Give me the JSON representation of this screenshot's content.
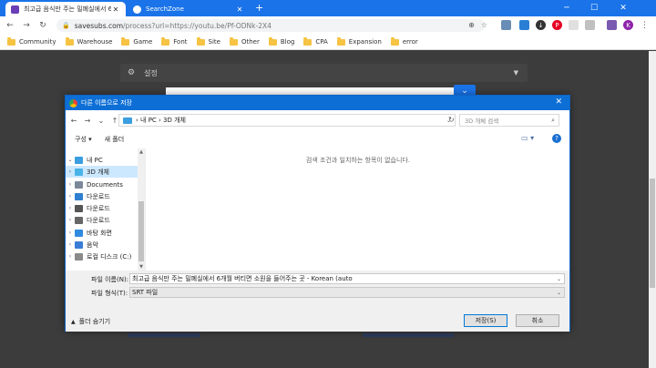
{
  "browser": {
    "tabs": [
      {
        "title": "최고급 음식만 주는 밀폐실에서 6..."
      },
      {
        "title": "SearchZone"
      }
    ],
    "new_tab": "+",
    "url_host": "savesubs.com",
    "url_path": "/process?url=https://youtu.be/Pf-ODNk-2X4",
    "avatar_letter": "K",
    "bookmarks": [
      "Community",
      "Warehouse",
      "Game",
      "Font",
      "Site",
      "Other",
      "Blog",
      "CPA",
      "Expansion",
      "error"
    ]
  },
  "page": {
    "settings_label": "설정"
  },
  "dialog": {
    "title": "다른 이름으로 저장",
    "breadcrumb": "›  내 PC  ›  3D 개체",
    "search_placeholder": "3D 개체 검색",
    "commands": {
      "organize": "구성 ▾",
      "new_folder": "새 폴더"
    },
    "nav_items": [
      {
        "label": "내 PC",
        "arrow": "⌄",
        "color": "#3a9ee0"
      },
      {
        "label": "3D 개체",
        "arrow": "›",
        "color": "#49b3e8"
      },
      {
        "label": "Documents",
        "arrow": "›",
        "color": "#7a8898"
      },
      {
        "label": "다운로드",
        "arrow": "›",
        "color": "#2f7fd1"
      },
      {
        "label": "다운로드",
        "arrow": "›",
        "color": "#555"
      },
      {
        "label": "다운로드",
        "arrow": "›",
        "color": "#666"
      },
      {
        "label": "바탕 화면",
        "arrow": "›",
        "color": "#2f8be0"
      },
      {
        "label": "음악",
        "arrow": "›",
        "color": "#3a7dd6"
      },
      {
        "label": "로컬 디스크 (C:)",
        "arrow": "›",
        "color": "#8a8a8a"
      }
    ],
    "empty_message": "검색 조건과 일치하는 항목이 없습니다.",
    "filename_label": "파일 이름(N):",
    "filename_value": "최고급 음식만 주는 밀폐실에서 6개월 버티면 소원을 들어주는 곳 - Korean (auto",
    "filetype_label": "파일 형식(T):",
    "filetype_value": "SRT 파일",
    "hide_folders": "폴더 숨기기",
    "save_button": "저장(S)",
    "cancel_button": "취소"
  }
}
